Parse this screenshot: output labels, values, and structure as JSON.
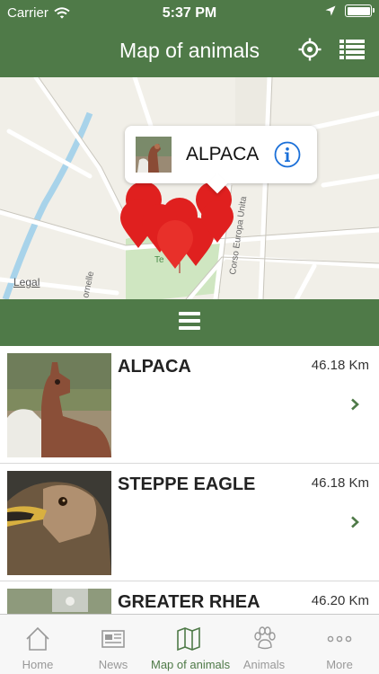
{
  "status_bar": {
    "carrier": "Carrier",
    "time": "5:37 PM"
  },
  "header": {
    "title": "Map of animals",
    "locate_icon": "crosshair-icon",
    "list_icon": "list-view-icon"
  },
  "map": {
    "legal": "Legal",
    "street_labels": [
      "Corso Europa Unita",
      "ornelle",
      "Te"
    ],
    "callout": {
      "name": "ALPACA"
    },
    "pin_color": "#e0201f"
  },
  "menu": {
    "icon": "hamburger-menu-icon"
  },
  "animals": [
    {
      "name": "ALPACA",
      "distance": "46.18 Km"
    },
    {
      "name": "STEPPE EAGLE",
      "distance": "46.18 Km"
    },
    {
      "name": "GREATER RHEA",
      "distance": "46.20 Km"
    }
  ],
  "tabs": [
    {
      "label": "Home",
      "icon": "house-icon"
    },
    {
      "label": "News",
      "icon": "newspaper-icon"
    },
    {
      "label": "Map of animals",
      "icon": "map-icon"
    },
    {
      "label": "Animals",
      "icon": "paw-icon"
    },
    {
      "label": "More",
      "icon": "more-dots-icon"
    }
  ],
  "colors": {
    "brand_green": "#4f7a48",
    "tab_inactive": "#999999"
  }
}
